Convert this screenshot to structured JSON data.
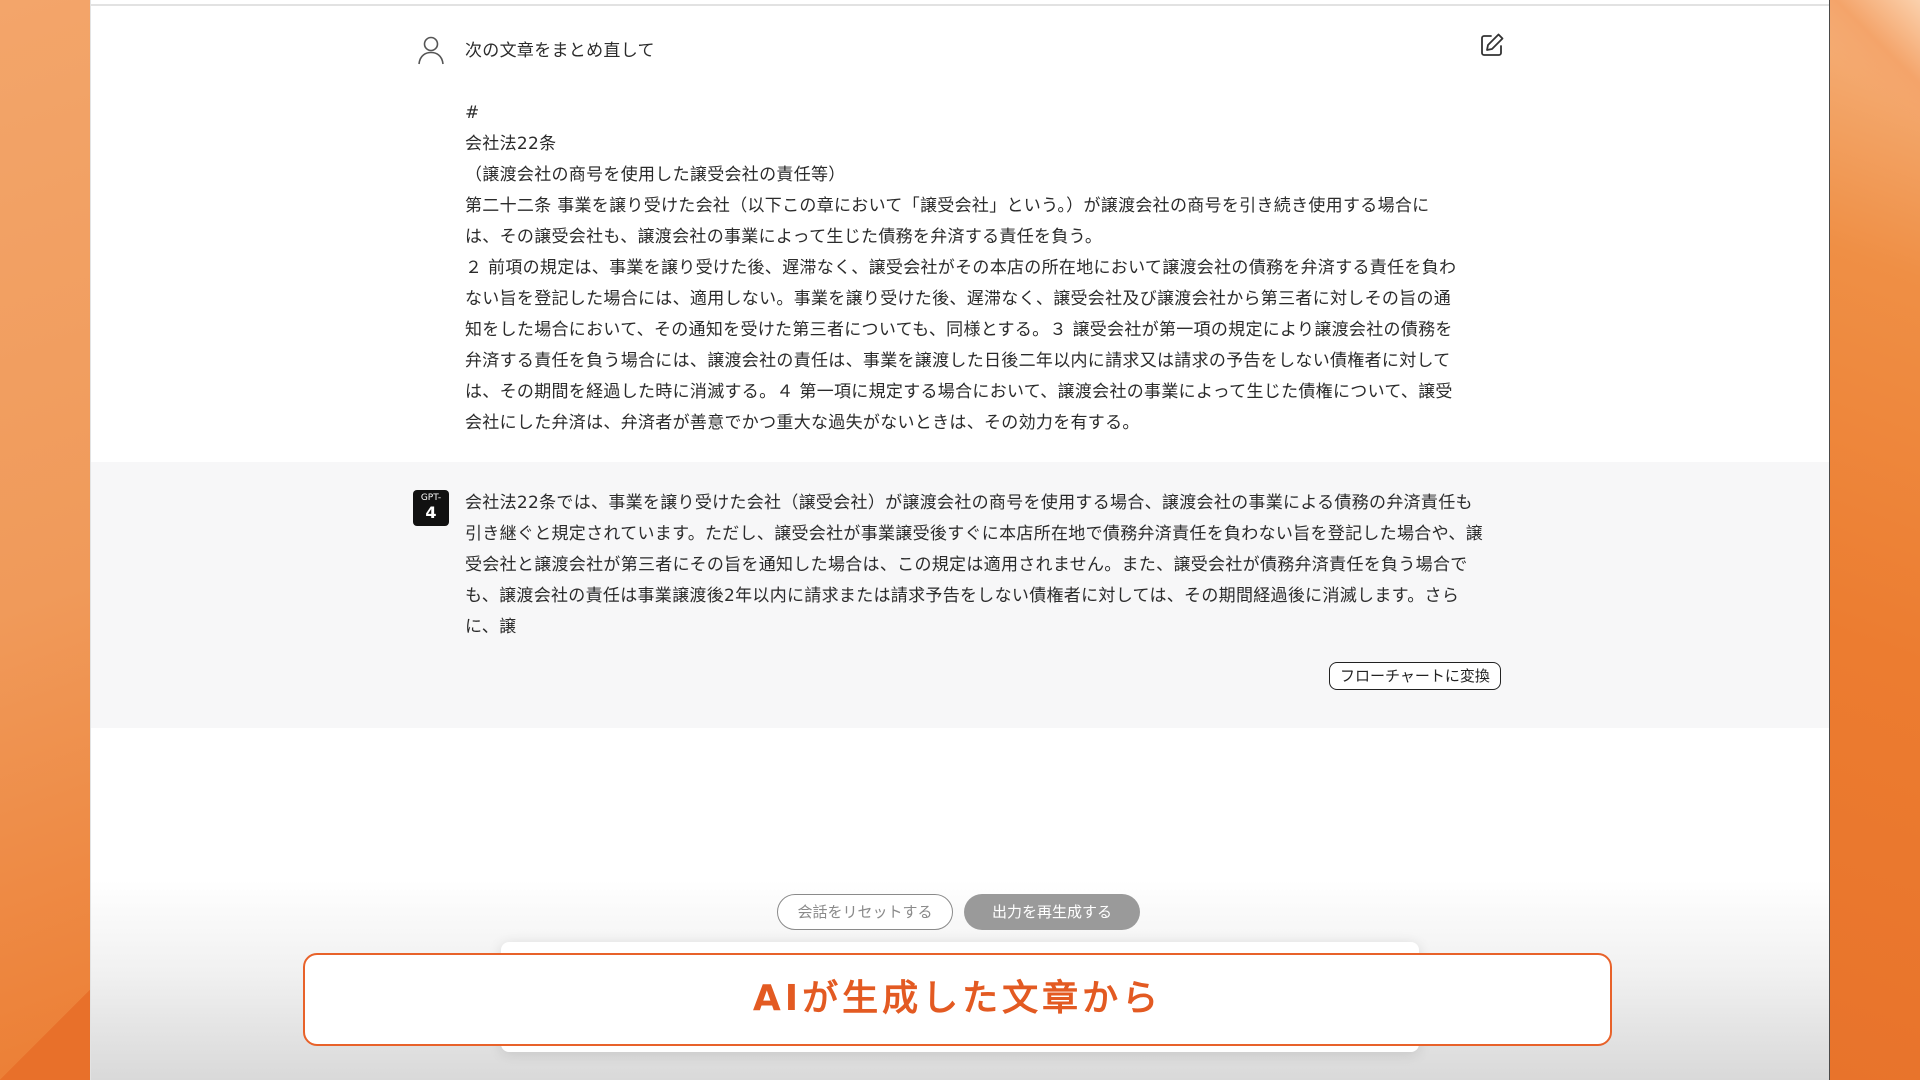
{
  "user_message": {
    "title": "次の文章をまとめ直して",
    "body_lines": [
      "#",
      "会社法22条",
      "（譲渡会社の商号を使用した譲受会社の責任等）",
      "第二十二条 事業を譲り受けた会社（以下この章において「譲受会社」という。）が譲渡会社の商号を引き続き使用する場合に",
      "は、その譲受会社も、譲渡会社の事業によって生じた債務を弁済する責任を負う。",
      "２ 前項の規定は、事業を譲り受けた後、遅滞なく、譲受会社がその本店の所在地において譲渡会社の債務を弁済する責任を負わ",
      "ない旨を登記した場合には、適用しない。事業を譲り受けた後、遅滞なく、譲受会社及び譲渡会社から第三者に対しその旨の通",
      "知をした場合において、その通知を受けた第三者についても、同様とする。３ 譲受会社が第一項の規定により譲渡会社の債務を",
      "弁済する責任を負う場合には、譲渡会社の責任は、事業を譲渡した日後二年以内に請求又は請求の予告をしない債権者に対して",
      "は、その期間を経過した時に消滅する。４ 第一項に規定する場合において、譲渡会社の事業によって生じた債権について、譲受",
      "会社にした弁済は、弁済者が善意でかつ重大な過失がないときは、その効力を有する。"
    ]
  },
  "ai_message": {
    "badge_top": "GPT-",
    "badge_bottom": "4",
    "lines": [
      "会社法22条では、事業を譲り受けた会社（譲受会社）が譲渡会社の商号を使用する場合、譲渡会社の事業による債務の弁済責任も",
      "引き継ぐと規定されています。ただし、譲受会社が事業譲受後すぐに本店所在地で債務弁済責任を負わない旨を登記した場合や、譲",
      "受会社と譲渡会社が第三者にその旨を通知した場合は、この規定は適用されません。また、譲受会社が債務弁済責任を負う場合で",
      "も、譲渡会社の責任は事業譲渡後2年以内に請求または請求予告をしない債権者に対しては、その期間経過後に消滅します。さら",
      "に、譲"
    ],
    "flowchart_button": "フローチャートに変換"
  },
  "actions": {
    "reset_label": "会話をリセットする",
    "regenerate_label": "出力を再生成する"
  },
  "caption": {
    "text": "AIが生成した文章から"
  },
  "icons": {
    "user_avatar": "user-icon",
    "edit": "edit-icon"
  },
  "colors": {
    "accent_orange": "#e8622a",
    "caption_text": "#e35a22"
  }
}
